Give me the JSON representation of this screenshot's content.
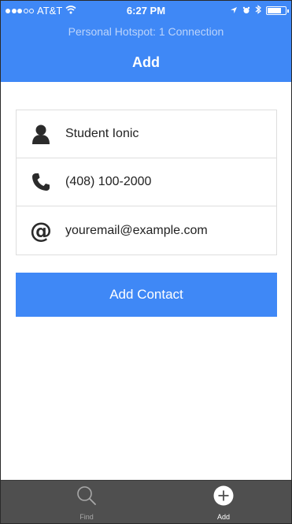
{
  "status_bar": {
    "carrier": "AT&T",
    "time": "6:27 PM",
    "signal_bars_filled": 3,
    "signal_bars_total": 5,
    "battery_level": 0.75
  },
  "hotspot": {
    "text": "Personal Hotspot: 1 Connection"
  },
  "nav": {
    "title": "Add"
  },
  "form": {
    "name_placeholder": "Student Ionic",
    "phone_placeholder": "(408) 100-2000",
    "email_placeholder": "youremail@example.com",
    "icons": [
      "person-icon",
      "phone-icon",
      "at-sign-icon"
    ]
  },
  "actions": {
    "add_contact_label": "Add Contact"
  },
  "tabbar": {
    "tabs": [
      {
        "label": "Find",
        "icon": "search-icon",
        "active": false
      },
      {
        "label": "Add",
        "icon": "plus-circle-icon",
        "active": true
      }
    ]
  },
  "colors": {
    "brand": "#3f88f6",
    "tabbar": "#4f4f4f"
  }
}
